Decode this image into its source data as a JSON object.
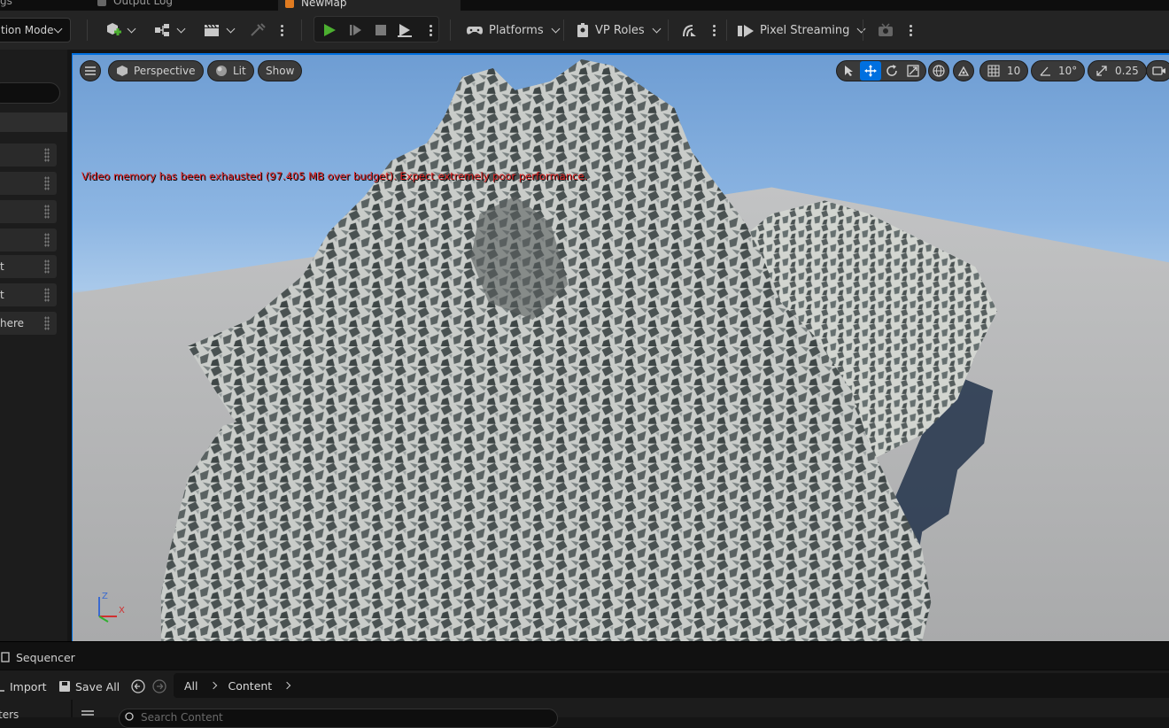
{
  "tabs": {
    "left_partial": "gs",
    "output_log": "Output Log",
    "new_map": "NewMap"
  },
  "toolbar": {
    "mode_select": "tion Mode",
    "platforms": "Platforms",
    "vp_roles": "VP Roles",
    "pixel_streaming": "Pixel Streaming"
  },
  "left_panel": {
    "items": [
      "",
      "",
      "",
      "",
      "t",
      "t",
      "here"
    ]
  },
  "viewport": {
    "menu_icon": "hamburger-icon",
    "perspective": "Perspective",
    "lit": "Lit",
    "show": "Show",
    "grid_snap": "10",
    "rotation_snap": "10°",
    "scale_snap": "0.25",
    "warning": "Video memory has been exhausted (97.405 MB over budget). Expect extremely poor performance.",
    "gizmo_z": "Z",
    "gizmo_x": "X"
  },
  "sequencer": {
    "label": "Sequencer"
  },
  "content_browser": {
    "import": "Import",
    "save_all": "Save All",
    "path": [
      "All",
      "Content"
    ],
    "search_placeholder": "Search Content",
    "left_label": "ters"
  },
  "colors": {
    "accent": "#0070e0",
    "play_green": "#4caf30",
    "warning_red": "#e02020",
    "ue_orange": "#e07b20"
  }
}
